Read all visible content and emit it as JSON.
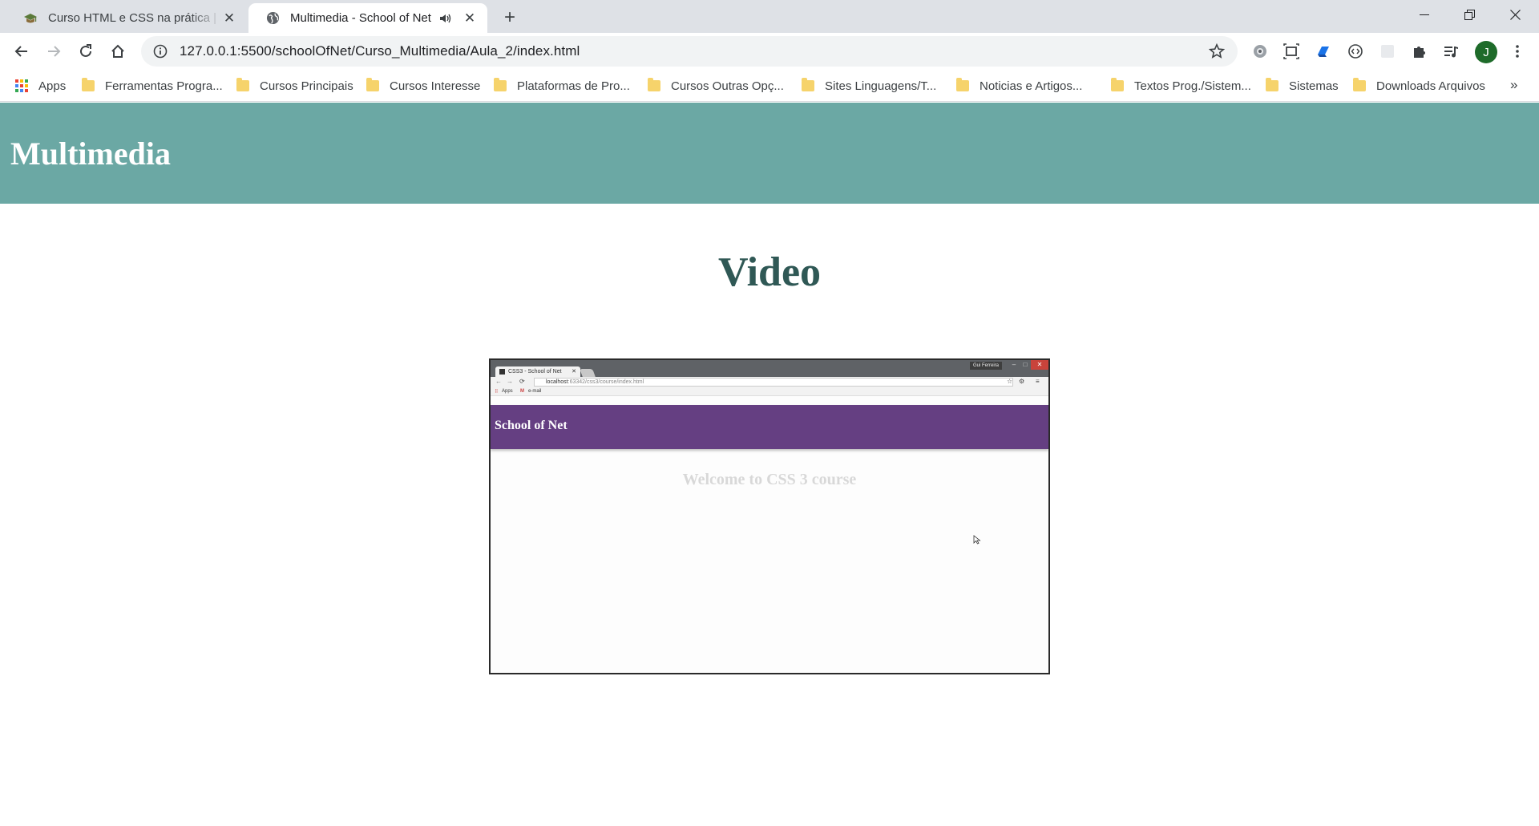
{
  "browser": {
    "tabs": [
      {
        "title": "Curso HTML e CSS na prática | School of Net",
        "active": false
      },
      {
        "title": "Multimedia - School of Net",
        "active": true
      }
    ],
    "new_tab_label": "+",
    "address": "127.0.0.1:5500/schoolOfNet/Curso_Multimedia/Aula_2/index.html",
    "profile_initial": "J",
    "bookmarks": [
      {
        "label": "Apps",
        "type": "apps"
      },
      {
        "label": "Ferramentas Progra...",
        "type": "folder"
      },
      {
        "label": "Cursos Principais",
        "type": "folder"
      },
      {
        "label": "Cursos Interesse",
        "type": "folder"
      },
      {
        "label": "Plataformas de Pro...",
        "type": "folder"
      },
      {
        "label": "Cursos Outras Opç...",
        "type": "folder"
      },
      {
        "label": "Sites Linguagens/T...",
        "type": "folder"
      },
      {
        "label": "Noticias e Artigos...",
        "type": "folder"
      },
      {
        "label": "Textos Prog./Sistem...",
        "type": "folder"
      },
      {
        "label": "Sistemas",
        "type": "folder"
      },
      {
        "label": "Downloads Arquivos",
        "type": "folder"
      }
    ],
    "bookmarks_overflow": "»"
  },
  "page": {
    "header_title": "Multimedia",
    "section_title": "Video",
    "header_color": "#6ba8a4",
    "title_color": "#2f5855"
  },
  "video": {
    "tab_title": "CSS3 - School of Net",
    "user_label": "Gui Ferreira",
    "address_host": "localhost",
    "address_path": ":63342/css3/course/index.html",
    "bookmark_apps": "Apps",
    "bookmark_email": "e-mail",
    "header_title": "School of Net",
    "header_color": "#653f82",
    "welcome_text": "Welcome to CSS 3 course"
  }
}
